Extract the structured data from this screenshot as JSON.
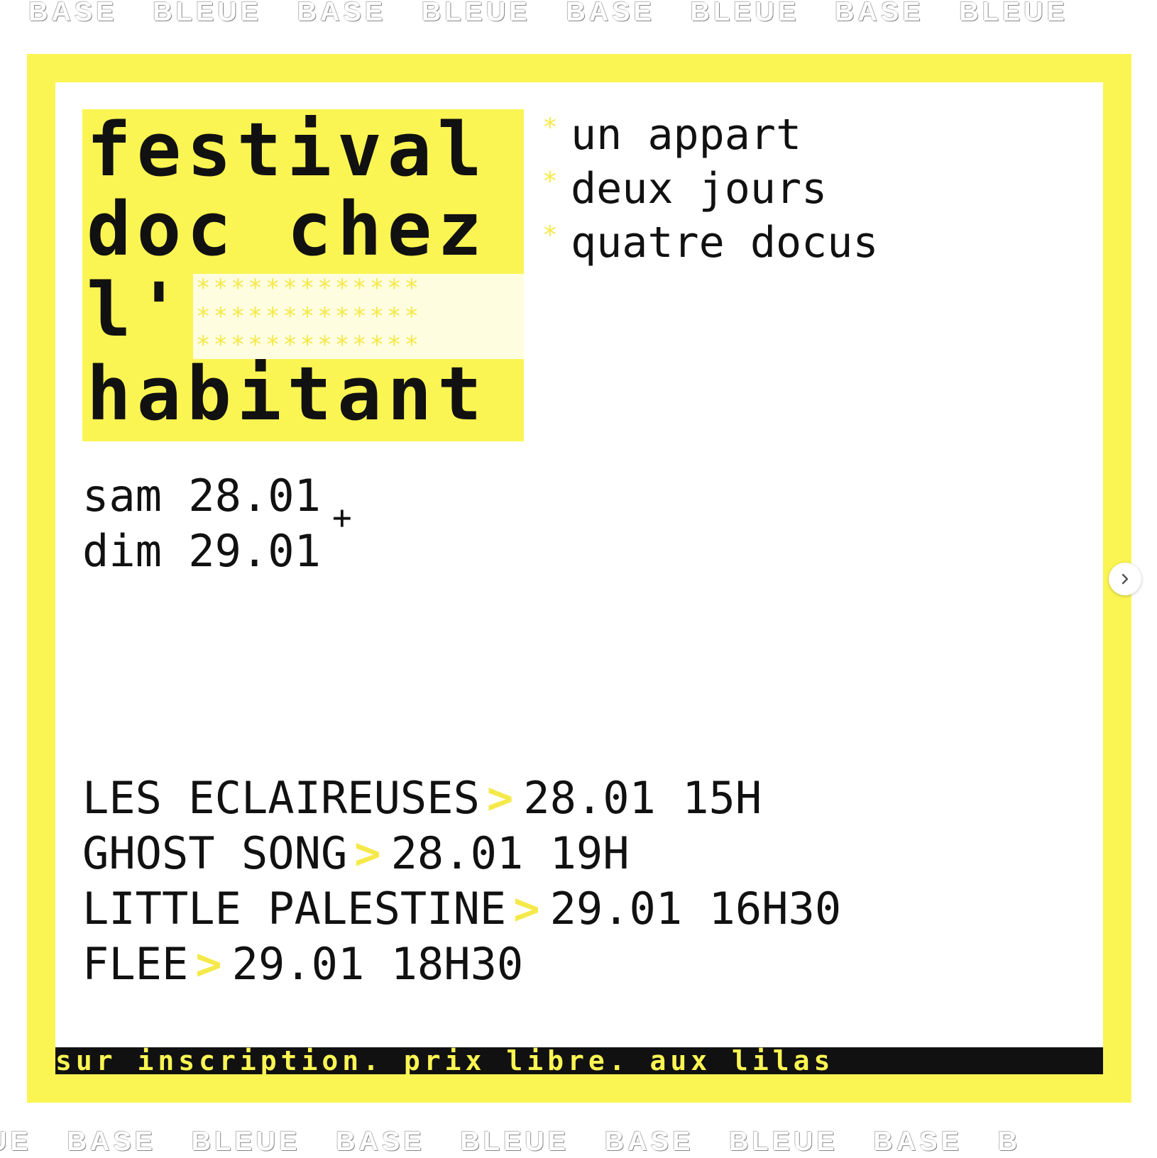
{
  "ticker_top": [
    "BASE",
    "BLEUE",
    "BASE",
    "BLEUE",
    "BASE",
    "BLEUE",
    "BASE",
    "BLEUE"
  ],
  "ticker_bottom": [
    "UE",
    "BASE",
    "BLEUE",
    "BASE",
    "BLEUE",
    "BASE",
    "BLEUE",
    "BASE",
    "B"
  ],
  "poster": {
    "title": {
      "line1": "festival",
      "line2": "doc chez",
      "line3": "l'",
      "line4": "habitant"
    },
    "stars_rows": [
      "*************",
      "*************",
      "*************"
    ],
    "taglines": [
      {
        "star": "*",
        "text": "un appart"
      },
      {
        "star": "*",
        "text": "deux jours"
      },
      {
        "star": "*",
        "text": "quatre docus"
      }
    ],
    "dates": {
      "line1": "sam 28.01",
      "line2": "dim 29.01",
      "plus": "+"
    },
    "screenings": [
      {
        "film": "LES ECLAIREUSES",
        "arrow": ">",
        "when": "28.01 15H"
      },
      {
        "film": "GHOST SONG",
        "arrow": ">",
        "when": "28.01 19H"
      },
      {
        "film": "LITTLE PALESTINE",
        "arrow": ">",
        "when": "29.01 16H30"
      },
      {
        "film": "FLEE",
        "arrow": ">",
        "when": "29.01 18H30"
      }
    ],
    "footer": "sur inscription. prix libre. aux lilas"
  },
  "next_button": {
    "icon": "chevron-right-icon"
  },
  "colors": {
    "yellow": "#fbf553",
    "black": "#111111",
    "white": "#ffffff"
  }
}
